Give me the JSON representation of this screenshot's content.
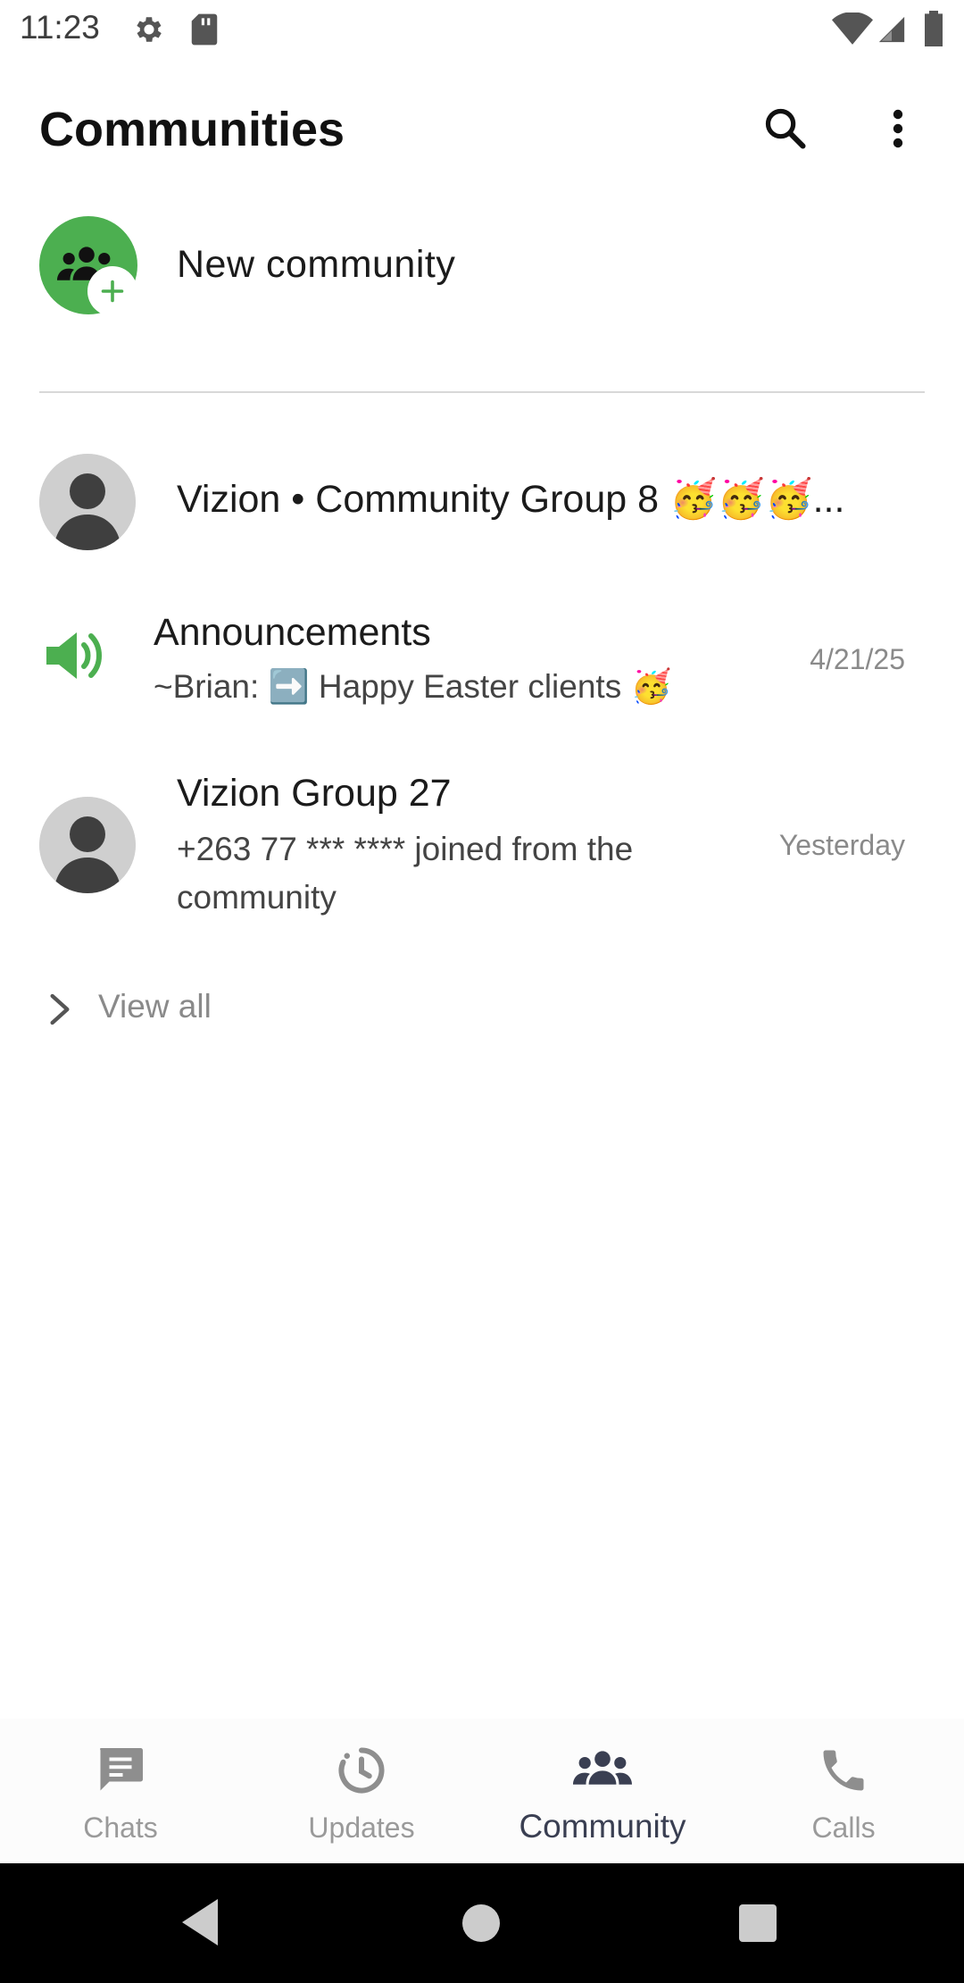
{
  "status_bar": {
    "time": "11:23",
    "icons": [
      "gear-icon",
      "sd-card-icon",
      "wifi-icon",
      "signal-icon",
      "battery-icon"
    ]
  },
  "header": {
    "title": "Communities",
    "actions": [
      "search-icon",
      "more-vert-icon"
    ]
  },
  "new_community": {
    "label": "New community",
    "avatar_color": "#4caf50"
  },
  "community": {
    "name": "Vizion • Community Group 8 🥳🥳🥳...",
    "chats": [
      {
        "title": "Announcements",
        "subtitle": "~Brian: ➡️ Happy Easter clients 🥳",
        "time": "4/21/25",
        "icon": "megaphone-icon"
      },
      {
        "title": "Vizion Group 27",
        "subtitle": "+263 77 *** **** joined from the community",
        "time": "Yesterday",
        "icon": "default-avatar-icon"
      }
    ],
    "view_all": "View all"
  },
  "bottom_nav": {
    "items": [
      {
        "label": "Chats",
        "icon": "chat-icon",
        "active": false
      },
      {
        "label": "Updates",
        "icon": "updates-icon",
        "active": false
      },
      {
        "label": "Community",
        "icon": "community-icon",
        "active": true
      },
      {
        "label": "Calls",
        "icon": "phone-icon",
        "active": false
      }
    ]
  },
  "colors": {
    "accent": "#4caf50",
    "text_primary": "#1b1b1b",
    "text_secondary": "#8a8a8a",
    "active_nav": "#3a3f52"
  }
}
